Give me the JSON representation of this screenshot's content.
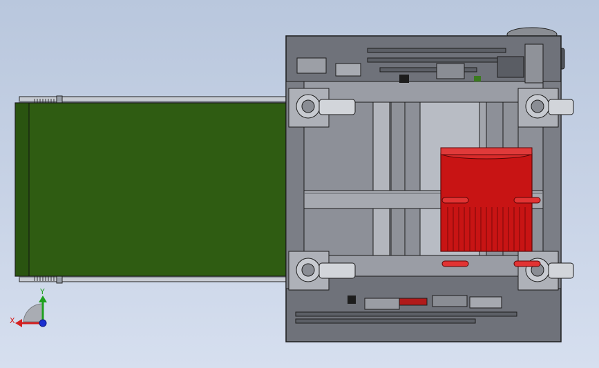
{
  "viewport": {
    "background_top": "#b9c7dd",
    "background_bottom": "#d6dfef"
  },
  "colors": {
    "belt": "#2f5c12",
    "belt_dark": "#244a0c",
    "frame": "#6f727a",
    "frame_light": "#b8bcc4",
    "motor": "#c81414",
    "motor_dark": "#8a0909",
    "outline": "#1c1c1c"
  },
  "triad": {
    "x_label": "X",
    "y_label": "Y",
    "x_color": "#d42020",
    "y_color": "#1ea01e",
    "z_color": "#1a2fd0"
  }
}
